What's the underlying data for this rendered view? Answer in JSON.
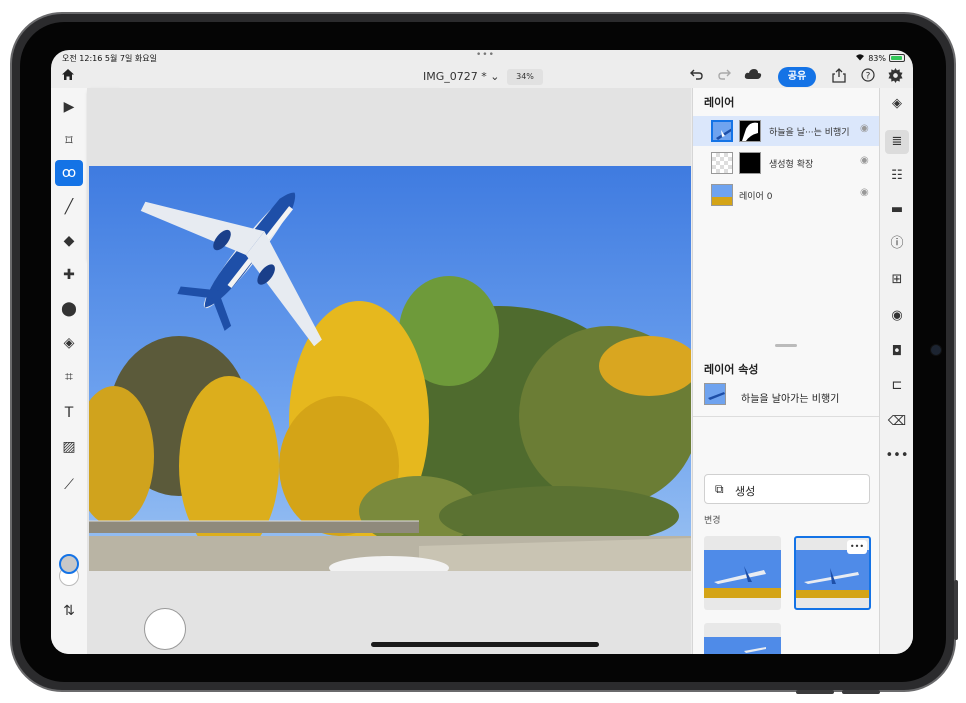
{
  "status": {
    "time": "오전 12:16  5월 7일 화요일",
    "dots": "•••",
    "battery": "83%"
  },
  "topbar": {
    "doc_name": "IMG_0727 * ⌄",
    "zoom": "34%",
    "share_label": "공유"
  },
  "layers_panel": {
    "title": "레이어",
    "layers": [
      {
        "name": "하늘을 날···는 비행기",
        "selected": true
      },
      {
        "name": "생성형 확장",
        "selected": false
      },
      {
        "name": "레이어 0",
        "selected": false
      }
    ]
  },
  "properties": {
    "title": "레이어 속성",
    "layer_name": "하늘을 날아가는 비행기",
    "generate_label": "생성",
    "variations_label": "변경",
    "more_label": "•••"
  },
  "colors": {
    "accent": "#1473e6",
    "foreground_chip": "#c8c8c8",
    "background_chip": "#ffffff"
  },
  "icons": {
    "left_tools": [
      "move-icon",
      "transform-icon",
      "lasso-icon",
      "brush-icon",
      "eraser-icon",
      "healing-icon",
      "clone-stamp-icon",
      "fill-icon",
      "crop-icon",
      "type-icon",
      "adjustment-icon",
      "eyedropper-icon"
    ],
    "right_rail": [
      "layers-icon",
      "layer-properties-icon",
      "adjustments-icon",
      "comments-icon",
      "info-icon",
      "add-layer-icon",
      "visibility-icon",
      "mask-icon",
      "merge-icon",
      "clear-icon",
      "more-icon"
    ]
  }
}
